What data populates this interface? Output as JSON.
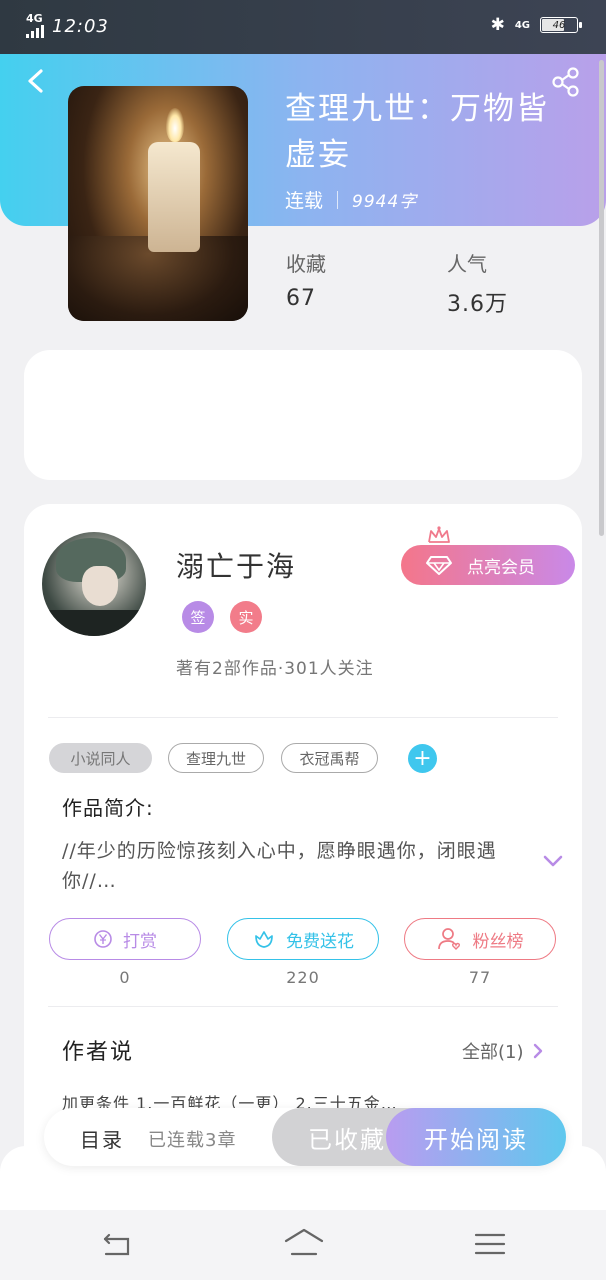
{
  "status_bar": {
    "network": "4G",
    "time": "12:03",
    "network_right": "4G",
    "battery": "46"
  },
  "book": {
    "title": "查理九世：万物皆虚妄",
    "status": "连载",
    "word_count": "9944字",
    "stats": [
      {
        "label": "收藏",
        "value": "67"
      },
      {
        "label": "人气",
        "value": "3.6万"
      }
    ]
  },
  "author": {
    "name": "溺亡于海",
    "badges": [
      {
        "label": "签",
        "color": "#b88be6"
      },
      {
        "label": "实",
        "color": "#f27c8a"
      }
    ],
    "subtitle": "著有2部作品·301人关注",
    "vip_button": "点亮会员"
  },
  "tags": [
    "小说同人",
    "查理九世",
    "衣冠禹帮"
  ],
  "intro": {
    "title": "作品简介:",
    "text": "//年少的历险惊孩刻入心中，愿睁眼遇你，闭眼遇你//…"
  },
  "actions": [
    {
      "label": "打赏",
      "count": "0",
      "color": "#b88be6",
      "icon": "yen-coin-icon"
    },
    {
      "label": "免费送花",
      "count": "220",
      "color": "#35c2e8",
      "icon": "flower-icon"
    },
    {
      "label": "粉丝榜",
      "count": "77",
      "color": "#ee7a84",
      "icon": "fans-user-icon"
    }
  ],
  "author_says": {
    "title": "作者说",
    "all_label": "全部(1)",
    "preview": "加更条件 1.一百鲜花（一更） 2.三十五金…"
  },
  "bottom_bar": {
    "catalog_label": "目录",
    "catalog_count": "已连载3章",
    "collected_label": "已收藏",
    "read_label": "开始阅读"
  },
  "colors": {
    "header_start": "#44d0ef",
    "header_end": "#b9a0ea",
    "accent_cyan": "#3fc7ee",
    "accent_purple": "#b99cf0"
  }
}
